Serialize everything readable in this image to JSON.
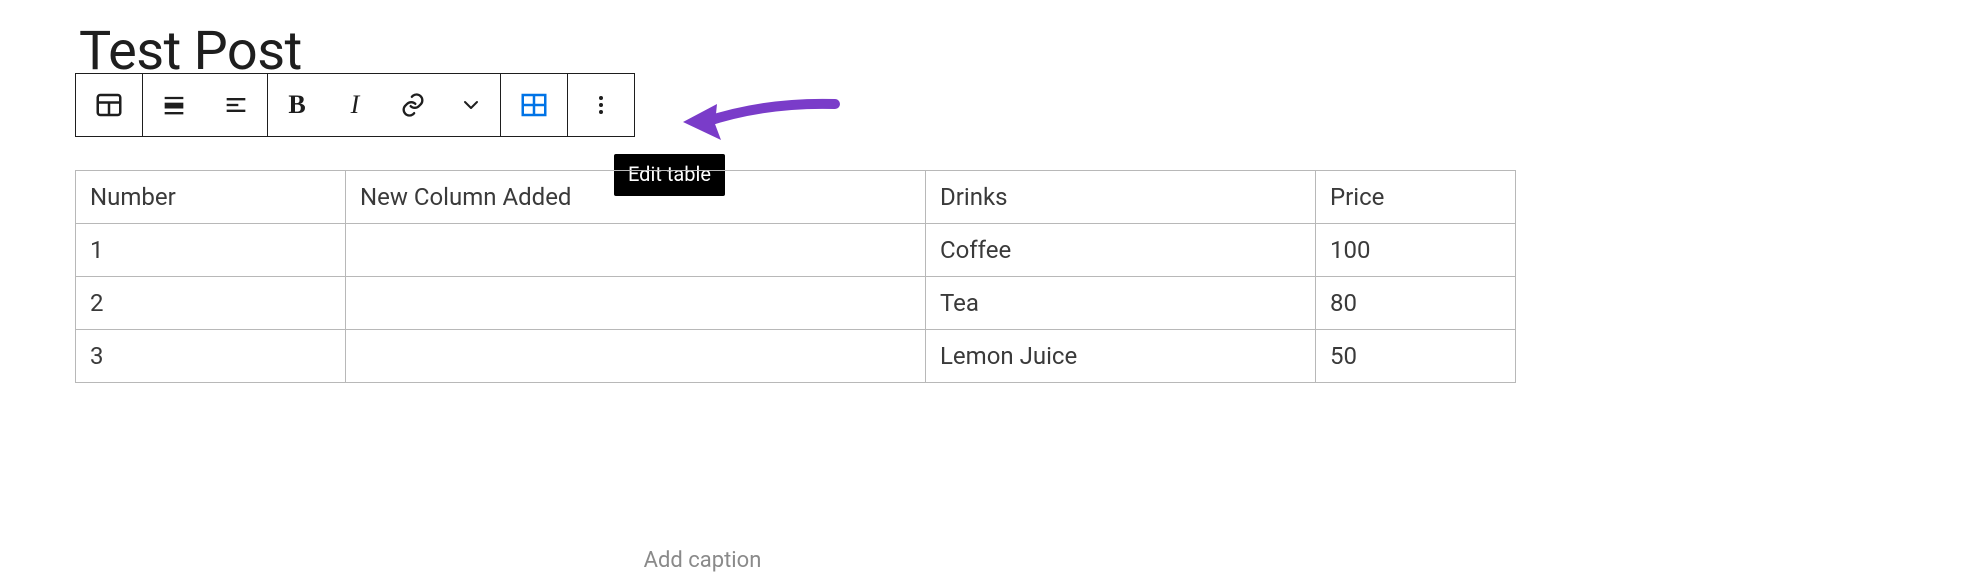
{
  "post": {
    "title": "Test Post"
  },
  "toolbar": {
    "blockTypeTooltip": "Table",
    "alignTooltip": "Change alignment",
    "justifyTooltip": "Change text alignment",
    "boldLabel": "B",
    "italicLabel": "I",
    "linkTooltip": "Link",
    "moreTooltip": "More",
    "editTableTooltip": "Edit table",
    "optionsTooltip": "Options"
  },
  "tooltip": {
    "text": "Edit table"
  },
  "table": {
    "headers": [
      "Number",
      "New Column Added",
      "Drinks",
      "Price"
    ],
    "rows": [
      [
        "1",
        "",
        "Coffee",
        "100"
      ],
      [
        "2",
        "",
        "Tea",
        "80"
      ],
      [
        "3",
        "",
        "Lemon Juice",
        "50"
      ]
    ],
    "captionPlaceholder": "Add caption"
  }
}
